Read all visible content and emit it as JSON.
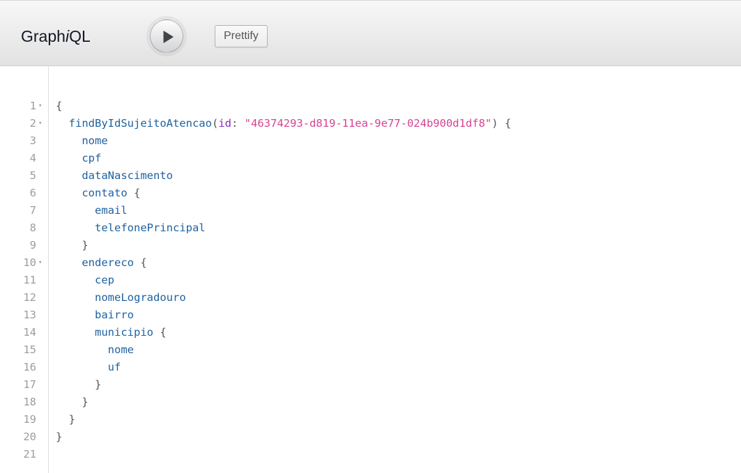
{
  "toolbar": {
    "title_main": "Graph",
    "title_italic": "i",
    "title_end": "QL",
    "execute_icon": "play-icon",
    "prettify_label": "Prettify"
  },
  "editor": {
    "lines": [
      {
        "n": "1",
        "fold": "▾",
        "tokens": [
          {
            "t": "{",
            "c": "punc"
          }
        ]
      },
      {
        "n": "2",
        "fold": "▾",
        "tokens": [
          {
            "t": "  ",
            "c": ""
          },
          {
            "t": "findByIdSujeitoAtencao",
            "c": "field"
          },
          {
            "t": "(",
            "c": "punc"
          },
          {
            "t": "id",
            "c": "attr"
          },
          {
            "t": ": ",
            "c": "punc"
          },
          {
            "t": "\"46374293-d819-11ea-9e77-024b900d1df8\"",
            "c": "str"
          },
          {
            "t": ") {",
            "c": "punc"
          }
        ]
      },
      {
        "n": "3",
        "fold": "",
        "tokens": [
          {
            "t": "    ",
            "c": ""
          },
          {
            "t": "nome",
            "c": "field"
          }
        ]
      },
      {
        "n": "4",
        "fold": "",
        "tokens": [
          {
            "t": "    ",
            "c": ""
          },
          {
            "t": "cpf",
            "c": "field"
          }
        ]
      },
      {
        "n": "5",
        "fold": "",
        "tokens": [
          {
            "t": "    ",
            "c": ""
          },
          {
            "t": "dataNascimento",
            "c": "field"
          }
        ]
      },
      {
        "n": "6",
        "fold": "",
        "tokens": [
          {
            "t": "    ",
            "c": ""
          },
          {
            "t": "contato",
            "c": "field"
          },
          {
            "t": " {",
            "c": "punc"
          }
        ]
      },
      {
        "n": "7",
        "fold": "",
        "tokens": [
          {
            "t": "      ",
            "c": ""
          },
          {
            "t": "email",
            "c": "field"
          }
        ]
      },
      {
        "n": "8",
        "fold": "",
        "tokens": [
          {
            "t": "      ",
            "c": ""
          },
          {
            "t": "telefonePrincipal",
            "c": "field"
          }
        ]
      },
      {
        "n": "9",
        "fold": "",
        "tokens": [
          {
            "t": "    ",
            "c": ""
          },
          {
            "t": "}",
            "c": "punc"
          }
        ]
      },
      {
        "n": "10",
        "fold": "▾",
        "tokens": [
          {
            "t": "    ",
            "c": ""
          },
          {
            "t": "endereco",
            "c": "field"
          },
          {
            "t": " {",
            "c": "punc"
          }
        ]
      },
      {
        "n": "11",
        "fold": "",
        "tokens": [
          {
            "t": "      ",
            "c": ""
          },
          {
            "t": "cep",
            "c": "field"
          }
        ]
      },
      {
        "n": "12",
        "fold": "",
        "tokens": [
          {
            "t": "      ",
            "c": ""
          },
          {
            "t": "nomeLogradouro",
            "c": "field"
          }
        ]
      },
      {
        "n": "13",
        "fold": "",
        "tokens": [
          {
            "t": "      ",
            "c": ""
          },
          {
            "t": "bairro",
            "c": "field"
          }
        ]
      },
      {
        "n": "14",
        "fold": "",
        "tokens": [
          {
            "t": "      ",
            "c": ""
          },
          {
            "t": "municipio",
            "c": "field"
          },
          {
            "t": " {",
            "c": "punc"
          }
        ]
      },
      {
        "n": "15",
        "fold": "",
        "tokens": [
          {
            "t": "        ",
            "c": ""
          },
          {
            "t": "nome",
            "c": "field"
          }
        ]
      },
      {
        "n": "16",
        "fold": "",
        "tokens": [
          {
            "t": "        ",
            "c": ""
          },
          {
            "t": "uf",
            "c": "field"
          }
        ]
      },
      {
        "n": "17",
        "fold": "",
        "tokens": [
          {
            "t": "      ",
            "c": ""
          },
          {
            "t": "}",
            "c": "punc"
          }
        ]
      },
      {
        "n": "18",
        "fold": "",
        "tokens": [
          {
            "t": "    ",
            "c": ""
          },
          {
            "t": "}",
            "c": "punc"
          }
        ]
      },
      {
        "n": "19",
        "fold": "",
        "tokens": [
          {
            "t": "  ",
            "c": ""
          },
          {
            "t": "}",
            "c": "punc"
          }
        ]
      },
      {
        "n": "20",
        "fold": "",
        "tokens": [
          {
            "t": "}",
            "c": "punc"
          }
        ]
      },
      {
        "n": "21",
        "fold": "",
        "tokens": []
      }
    ]
  },
  "colors": {
    "field": "#1f61a0",
    "argument": "#8b2bb9",
    "string": "#d64292",
    "punctuation": "#555555",
    "line_number": "#9c9c9c"
  }
}
